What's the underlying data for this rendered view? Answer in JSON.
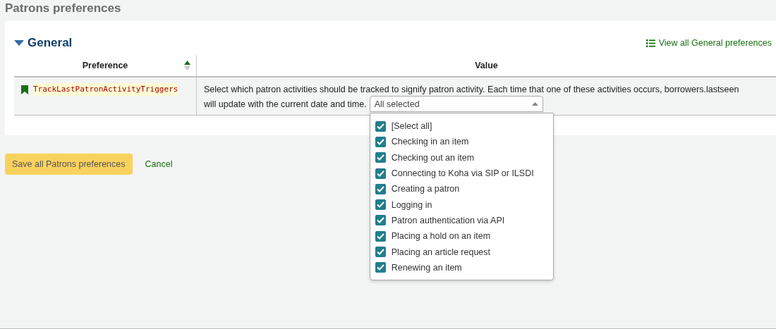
{
  "page_title": "Patrons preferences",
  "section": {
    "title": "General",
    "expanded": true,
    "view_all_link": "View all General preferences"
  },
  "table": {
    "columns": [
      {
        "label": "Preference",
        "sorted": true
      },
      {
        "label": "Value",
        "sorted": false
      }
    ],
    "rows": [
      {
        "name": "TrackLastPatronActivityTriggers",
        "description_lines": [
          "Select which patron activities should be tracked to signify patron activity. Each time that one of these activities occurs, borrowers.lastseen",
          "will update with the current date and time."
        ],
        "select": {
          "value": "All selected",
          "open": true,
          "options": [
            {
              "label": "[Select all]",
              "checked": true
            },
            {
              "label": "Checking in an item",
              "checked": true
            },
            {
              "label": "Checking out an item",
              "checked": true
            },
            {
              "label": "Connecting to Koha via SIP or ILSDI",
              "checked": true
            },
            {
              "label": "Creating a patron",
              "checked": true
            },
            {
              "label": "Logging in",
              "checked": true
            },
            {
              "label": "Patron authentication via API",
              "checked": true
            },
            {
              "label": "Placing a hold on an item",
              "checked": true
            },
            {
              "label": "Placing an article request",
              "checked": true
            },
            {
              "label": "Renewing an item",
              "checked": true
            }
          ]
        }
      }
    ]
  },
  "buttons": {
    "save": "Save all Patrons preferences",
    "cancel": "Cancel"
  }
}
